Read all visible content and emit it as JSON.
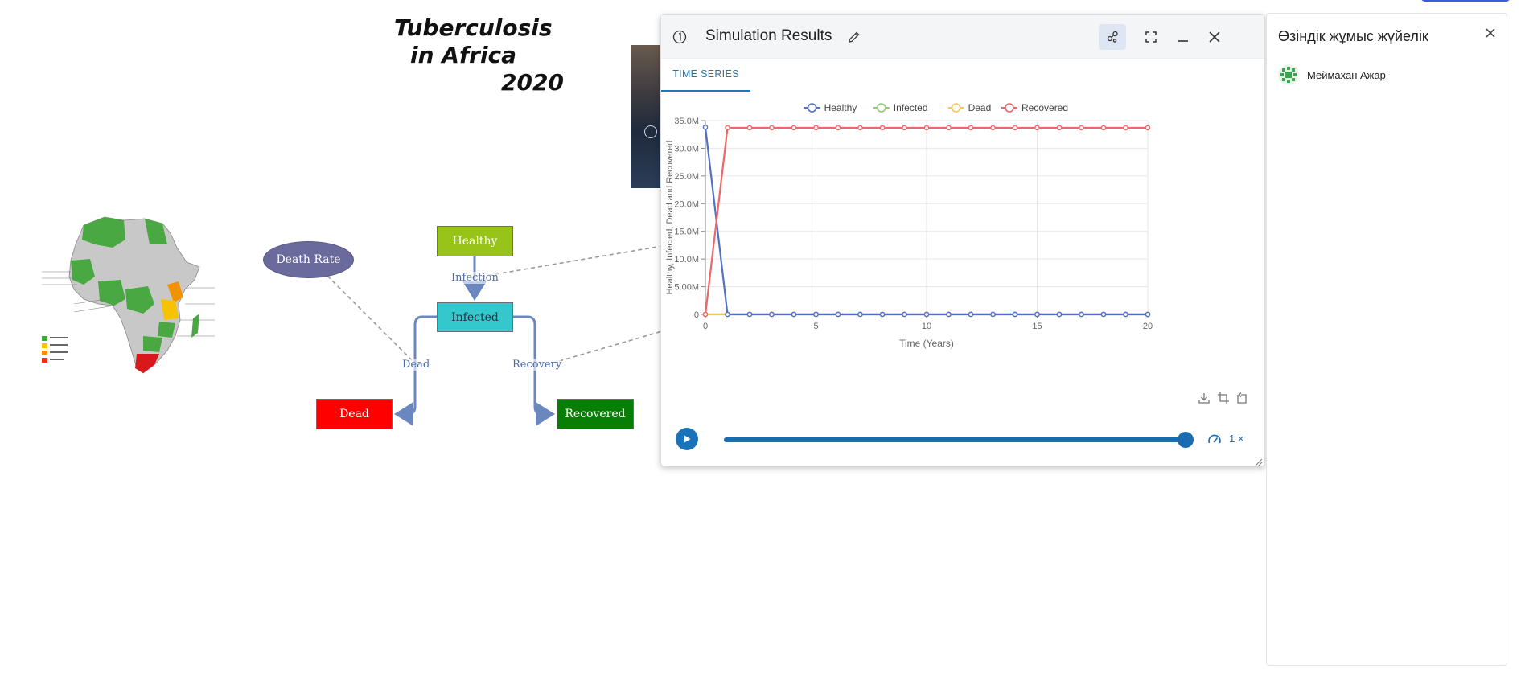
{
  "canvas": {
    "title_lines": [
      "Tuberculosis",
      "in Africa",
      "2020"
    ],
    "nodes": {
      "healthy": "Healthy",
      "infected": "Infected",
      "dead": "Dead",
      "recovered": "Recovered",
      "death_rate": "Death Rate"
    },
    "flows": {
      "infection": "Infection",
      "dead": "Dead",
      "recovery": "Recovery"
    },
    "map": {
      "legend_colors": [
        "#3fa535",
        "#f7c300",
        "#f29200",
        "#e63312",
        "#d7191c"
      ],
      "land_color": "#c8c8c8",
      "country_color": "#4aa843"
    }
  },
  "results": {
    "number_icon": "circled-one-icon",
    "title": "Simulation Results",
    "buttons": [
      "edit-icon",
      "share-icon",
      "fullscreen-icon",
      "minimize-icon",
      "close-icon"
    ],
    "tab": "TIME SERIES",
    "speed": "1 ×",
    "slider_position": 1.0
  },
  "chart_data": {
    "type": "line",
    "xlabel": "Time (Years)",
    "ylabel": "Healthy, Infected, Dead and Recovered",
    "xlim": [
      0,
      20
    ],
    "ylim": [
      0,
      35000000
    ],
    "xticks": [
      "0",
      "5",
      "10",
      "15",
      "20"
    ],
    "yticks": [
      "0",
      "5.00M",
      "10.0M",
      "15.0M",
      "20.0M",
      "25.0M",
      "30.0M",
      "35.0M"
    ],
    "legend_position": "top-center",
    "grid": true,
    "x": [
      0,
      1,
      2,
      3,
      4,
      5,
      6,
      7,
      8,
      9,
      10,
      11,
      12,
      13,
      14,
      15,
      16,
      17,
      18,
      19,
      20
    ],
    "series": [
      {
        "name": "Healthy",
        "color": "#5470c6",
        "values": [
          33800000,
          0,
          0,
          0,
          0,
          0,
          0,
          0,
          0,
          0,
          0,
          0,
          0,
          0,
          0,
          0,
          0,
          0,
          0,
          0,
          0
        ]
      },
      {
        "name": "Infected",
        "color": "#91cc75",
        "values": [
          0,
          0,
          0,
          0,
          0,
          0,
          0,
          0,
          0,
          0,
          0,
          0,
          0,
          0,
          0,
          0,
          0,
          0,
          0,
          0,
          0
        ]
      },
      {
        "name": "Dead",
        "color": "#fac858",
        "values": [
          0,
          60000,
          60000,
          60000,
          60000,
          60000,
          60000,
          60000,
          60000,
          60000,
          60000,
          60000,
          60000,
          60000,
          60000,
          60000,
          60000,
          60000,
          60000,
          60000,
          60000
        ]
      },
      {
        "name": "Recovered",
        "color": "#ee6666",
        "values": [
          0,
          33700000,
          33700000,
          33700000,
          33700000,
          33700000,
          33700000,
          33700000,
          33700000,
          33700000,
          33700000,
          33700000,
          33700000,
          33700000,
          33700000,
          33700000,
          33700000,
          33700000,
          33700000,
          33700000,
          33700000
        ]
      }
    ]
  },
  "side_panel": {
    "title": "Өзіндік жұмыс жүйелік",
    "user_name": "Меймахан Ажар",
    "avatar_color": "#3aa64c"
  }
}
